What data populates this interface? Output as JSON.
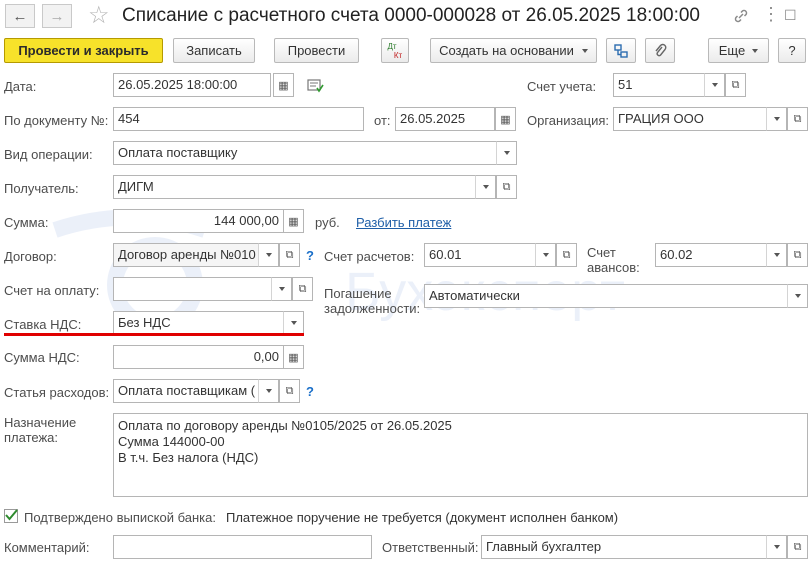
{
  "window": {
    "title": "Списание с расчетного счета 0000-000028 от 26.05.2025 18:00:00"
  },
  "toolbar": {
    "post_close": "Провести и закрыть",
    "save": "Записать",
    "post": "Провести",
    "dtkt_top": "Дт",
    "dtkt_bottom": "Кт",
    "create_based": "Создать на основании",
    "more": "Еще",
    "help": "?"
  },
  "form": {
    "date_label": "Дата:",
    "date_value": "26.05.2025 18:00:00",
    "account_label": "Счет учета:",
    "account_value": "51",
    "docnum_label": "По документу №:",
    "docnum_value": "454",
    "from_label": "от:",
    "from_value": "26.05.2025",
    "org_label": "Организация:",
    "org_value": "ГРАЦИЯ ООО",
    "optype_label": "Вид операции:",
    "optype_value": "Оплата поставщику",
    "recipient_label": "Получатель:",
    "recipient_value": "ДИГМ",
    "sum_label": "Сумма:",
    "sum_value": "144 000,00",
    "currency": "руб.",
    "split_link": "Разбить платеж",
    "contract_label": "Договор:",
    "contract_value": "Договор аренды №010",
    "settle_acc_label": "Счет расчетов:",
    "settle_acc_value": "60.01",
    "advance_acc_label_1": "Счет",
    "advance_acc_label_2": "авансов:",
    "advance_acc_value": "60.02",
    "invoice_label": "Счет на оплату:",
    "invoice_value": "",
    "repay_label_1": "Погашение",
    "repay_label_2": "задолженности:",
    "repay_value": "Автоматически",
    "vat_rate_label": "Ставка НДС:",
    "vat_rate_value": "Без НДС",
    "vat_sum_label": "Сумма НДС:",
    "vat_sum_value": "0,00",
    "expense_label": "Статья расходов:",
    "expense_value": "Оплата поставщикам (",
    "purpose_label_1": "Назначение",
    "purpose_label_2": "платежа:",
    "purpose_value": "Оплата по договору аренды №0105/2025 от 26.05.2025\nСумма 144000-00\nВ т.ч. Без налога (НДС)",
    "confirmed_label": "Подтверждено выпиской банка:",
    "confirmed_checked": true,
    "confirmed_note": "Платежное поручение не требуется (документ исполнен банком)",
    "comment_label": "Комментарий:",
    "comment_value": "",
    "responsible_label": "Ответственный:",
    "responsible_value": "Главный бухгалтер"
  },
  "watermark": {
    "text": "Бухэксперт"
  },
  "colors": {
    "primary_button": "#f7e22a",
    "underline": "#e00000",
    "link": "#1f5fa8"
  }
}
